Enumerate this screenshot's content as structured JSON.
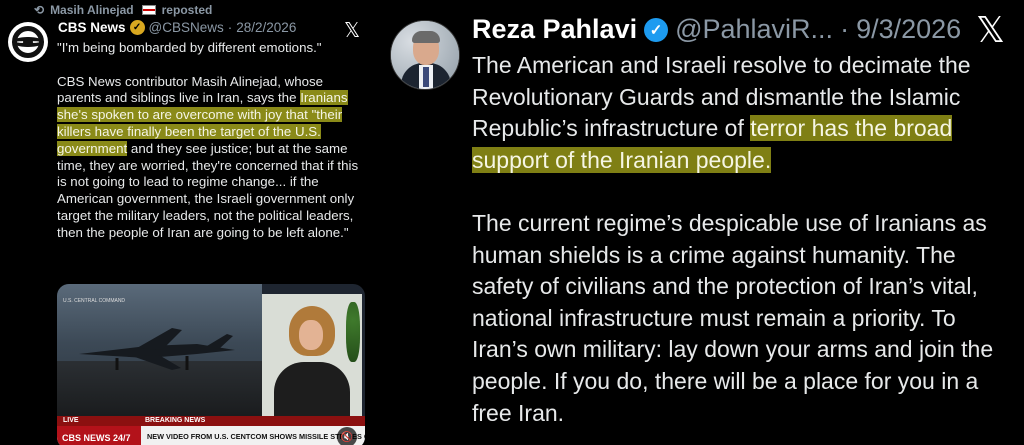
{
  "left_tweet": {
    "repost_label": "Masih Alinejad",
    "repost_suffix": "reposted",
    "author_name": "CBS News",
    "author_handle": "@CBSNews",
    "date": "28/2/2026",
    "quote": "\"I'm being bombarded by different emotions.\"",
    "body_1": "CBS News contributor Masih Alinejad, whose parents and siblings live in Iran, says the",
    "body_highlight": "Iranians she's spoken to are overcome with joy that \"their killers have finally been the target of the U.S. government",
    "body_2": "and they see justice; but at the same time, they are worried, they're concerned that if this is not going to lead to regime change... if the American government, the Israeli government only target the military leaders, not the political leaders, then the people of Iran are going to be left alone.\"",
    "video": {
      "source_label": "U.S. CENTRAL COMMAND",
      "live_label": "LIVE",
      "breaking_label": "BREAKING NEWS",
      "brand": "CBS NEWS 24/7",
      "ticker": "NEW VIDEO FROM U.S. CENTCOM SHOWS MISSILE STRIKES ON IRAN"
    }
  },
  "right_tweet": {
    "author_name": "Reza Pahlavi",
    "author_handle": "@PahlaviR...",
    "date": "9/3/2026",
    "para1_start": "The American and Israeli resolve to decimate the Revolutionary Guards and dismantle the Islamic Republic’s infrastructure of",
    "para1_highlight": "terror has the broad support of the Iranian people.",
    "para2": "The current regime’s despicable use of Iranians as human shields is a crime against humanity. The safety of civilians and the protection of Iran’s vital, national infrastructure must remain a priority. To Iran’s own military: lay down your arms and join the people. If you do, there will be a place for you in a free Iran."
  },
  "icons": {
    "repost": "repost-icon",
    "verified": "verified-badge-icon",
    "x_logo": "x-logo-icon",
    "mute": "mute-icon"
  },
  "colors": {
    "background": "#000000",
    "highlight": "#8a8a18",
    "verified_gold": "#d9a820",
    "verified_blue": "#1d9bf0",
    "muted_text": "#8b98a5"
  }
}
